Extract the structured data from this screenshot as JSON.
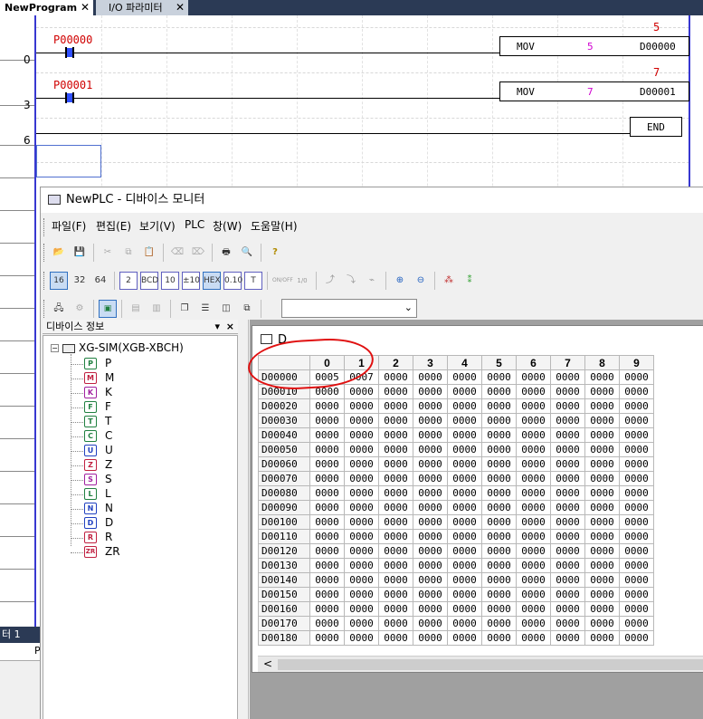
{
  "tabs": [
    {
      "label": "NewProgram",
      "close": "✕"
    },
    {
      "label": "I/O 파라미터",
      "close": "✕"
    }
  ],
  "ladder": {
    "steps": [
      "0",
      "3",
      "6"
    ],
    "rungs": [
      {
        "contact": "P00000",
        "instr": "MOV",
        "source": "5",
        "dest": "D00000",
        "monitor": "5"
      },
      {
        "contact": "P00001",
        "instr": "MOV",
        "source": "7",
        "dest": "D00001",
        "monitor": "7"
      }
    ],
    "end_label": "END"
  },
  "bottom_panel": {
    "title": "터 1",
    "col": "P"
  },
  "monitor": {
    "title": "NewPLC - 디바이스 모니터",
    "menu": [
      "파일(F)",
      "편집(E)",
      "보기(V)",
      "PLC",
      "창(W)",
      "도움말(H)"
    ],
    "toolbar2": [
      "16",
      "32",
      "64",
      "2",
      "BCD",
      "10",
      "±10",
      "HEX",
      "0.10",
      "T"
    ],
    "toolbar2_extra": [
      "ON/OFF",
      "1/0"
    ],
    "tree_header": "디바이스 정보",
    "tree_header_pin": "▾",
    "tree_header_close": "×",
    "tree_root": "XG-SIM(XGB-XBCH)",
    "devices": [
      "P",
      "M",
      "K",
      "F",
      "T",
      "C",
      "U",
      "Z",
      "S",
      "L",
      "N",
      "D",
      "R",
      "ZR"
    ],
    "selected_device": "D",
    "data_window_title": "D",
    "columns": [
      "0",
      "1",
      "2",
      "3",
      "4",
      "5",
      "6",
      "7",
      "8",
      "9"
    ],
    "rows": [
      {
        "addr": "D00000",
        "values": [
          "0005",
          "0007",
          "0000",
          "0000",
          "0000",
          "0000",
          "0000",
          "0000",
          "0000",
          "0000"
        ]
      },
      {
        "addr": "D00010",
        "values": [
          "0000",
          "0000",
          "0000",
          "0000",
          "0000",
          "0000",
          "0000",
          "0000",
          "0000",
          "0000"
        ]
      },
      {
        "addr": "D00020",
        "values": [
          "0000",
          "0000",
          "0000",
          "0000",
          "0000",
          "0000",
          "0000",
          "0000",
          "0000",
          "0000"
        ]
      },
      {
        "addr": "D00030",
        "values": [
          "0000",
          "0000",
          "0000",
          "0000",
          "0000",
          "0000",
          "0000",
          "0000",
          "0000",
          "0000"
        ]
      },
      {
        "addr": "D00040",
        "values": [
          "0000",
          "0000",
          "0000",
          "0000",
          "0000",
          "0000",
          "0000",
          "0000",
          "0000",
          "0000"
        ]
      },
      {
        "addr": "D00050",
        "values": [
          "0000",
          "0000",
          "0000",
          "0000",
          "0000",
          "0000",
          "0000",
          "0000",
          "0000",
          "0000"
        ]
      },
      {
        "addr": "D00060",
        "values": [
          "0000",
          "0000",
          "0000",
          "0000",
          "0000",
          "0000",
          "0000",
          "0000",
          "0000",
          "0000"
        ]
      },
      {
        "addr": "D00070",
        "values": [
          "0000",
          "0000",
          "0000",
          "0000",
          "0000",
          "0000",
          "0000",
          "0000",
          "0000",
          "0000"
        ]
      },
      {
        "addr": "D00080",
        "values": [
          "0000",
          "0000",
          "0000",
          "0000",
          "0000",
          "0000",
          "0000",
          "0000",
          "0000",
          "0000"
        ]
      },
      {
        "addr": "D00090",
        "values": [
          "0000",
          "0000",
          "0000",
          "0000",
          "0000",
          "0000",
          "0000",
          "0000",
          "0000",
          "0000"
        ]
      },
      {
        "addr": "D00100",
        "values": [
          "0000",
          "0000",
          "0000",
          "0000",
          "0000",
          "0000",
          "0000",
          "0000",
          "0000",
          "0000"
        ]
      },
      {
        "addr": "D00110",
        "values": [
          "0000",
          "0000",
          "0000",
          "0000",
          "0000",
          "0000",
          "0000",
          "0000",
          "0000",
          "0000"
        ]
      },
      {
        "addr": "D00120",
        "values": [
          "0000",
          "0000",
          "0000",
          "0000",
          "0000",
          "0000",
          "0000",
          "0000",
          "0000",
          "0000"
        ]
      },
      {
        "addr": "D00130",
        "values": [
          "0000",
          "0000",
          "0000",
          "0000",
          "0000",
          "0000",
          "0000",
          "0000",
          "0000",
          "0000"
        ]
      },
      {
        "addr": "D00140",
        "values": [
          "0000",
          "0000",
          "0000",
          "0000",
          "0000",
          "0000",
          "0000",
          "0000",
          "0000",
          "0000"
        ]
      },
      {
        "addr": "D00150",
        "values": [
          "0000",
          "0000",
          "0000",
          "0000",
          "0000",
          "0000",
          "0000",
          "0000",
          "0000",
          "0000"
        ]
      },
      {
        "addr": "D00160",
        "values": [
          "0000",
          "0000",
          "0000",
          "0000",
          "0000",
          "0000",
          "0000",
          "0000",
          "0000",
          "0000"
        ]
      },
      {
        "addr": "D00170",
        "values": [
          "0000",
          "0000",
          "0000",
          "0000",
          "0000",
          "0000",
          "0000",
          "0000",
          "0000",
          "0000"
        ]
      },
      {
        "addr": "D00180",
        "values": [
          "0000",
          "0000",
          "0000",
          "0000",
          "0000",
          "0000",
          "0000",
          "0000",
          "0000",
          "0000"
        ]
      }
    ],
    "scroll_left": "<"
  },
  "colors": {
    "rail": "#3838d0",
    "contact_label": "#d00000",
    "mov_value": "#d000d0",
    "annotation": "#e01010",
    "tab_bar": "#2b3a55"
  }
}
